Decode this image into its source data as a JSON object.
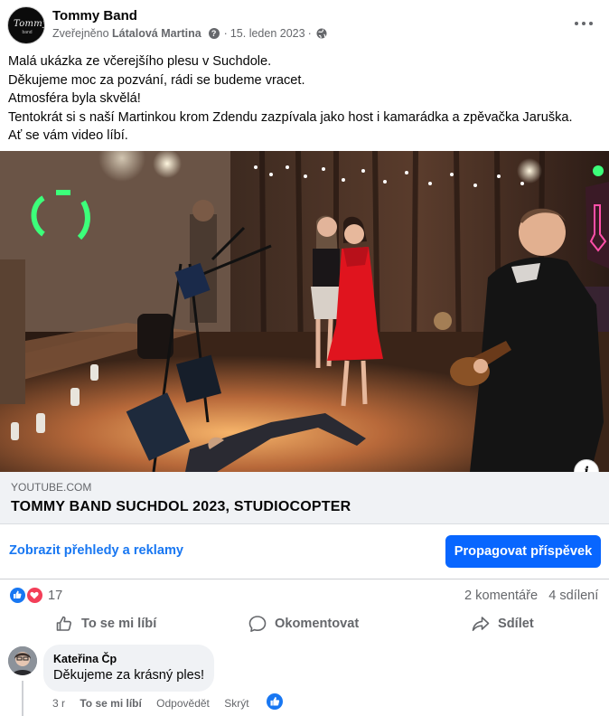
{
  "post": {
    "page_name": "Tommy Band",
    "published_by_prefix": "Zveřejněno",
    "author": "Látalová Martina",
    "date": "15. leden 2023",
    "separator": "·",
    "avatar_text": "Tommy",
    "avatar_sub": "band",
    "text_lines": [
      "Malá ukázka ze včerejšího plesu v Suchdole.",
      "Děkujeme moc za pozvání, rádi se budeme vracet.",
      "Atmosféra byla skvělá!",
      "Tentokrát si s naší Martinkou krom Zdendu zazpívala jako host i kamarádka a zpěvačka Jaruška.",
      "Ať se vám video líbí."
    ]
  },
  "link_preview": {
    "domain": "YOUTUBE.COM",
    "title": "TOMMY BAND SUCHDOL 2023, STUDIOCOPTER",
    "info_label": "i"
  },
  "insights": {
    "link_label": "Zobrazit přehledy a reklamy",
    "promote_label": "Propagovat příspěvek"
  },
  "engagement": {
    "reaction_count": "17",
    "comments": "2 komentáře",
    "shares": "4 sdílení"
  },
  "actions": {
    "like": "To se mi líbí",
    "comment": "Okomentovat",
    "share": "Sdílet"
  },
  "comment": {
    "author": "Kateřina Čp",
    "text": "Děkujeme za krásný ples!",
    "age": "3 r",
    "like": "To se mi líbí",
    "reply": "Odpovědět",
    "hide": "Skrýt"
  },
  "colors": {
    "accent": "#1877f2",
    "promote": "#0866ff",
    "love": "#f33e58",
    "muted": "#65676b",
    "dress": "#e0141e"
  },
  "icons": [
    "help-icon",
    "globe-icon",
    "more-icon",
    "info-icon",
    "like-reaction-icon",
    "love-reaction-icon",
    "thumb-up-icon",
    "speech-bubble-icon",
    "share-arrow-icon"
  ]
}
